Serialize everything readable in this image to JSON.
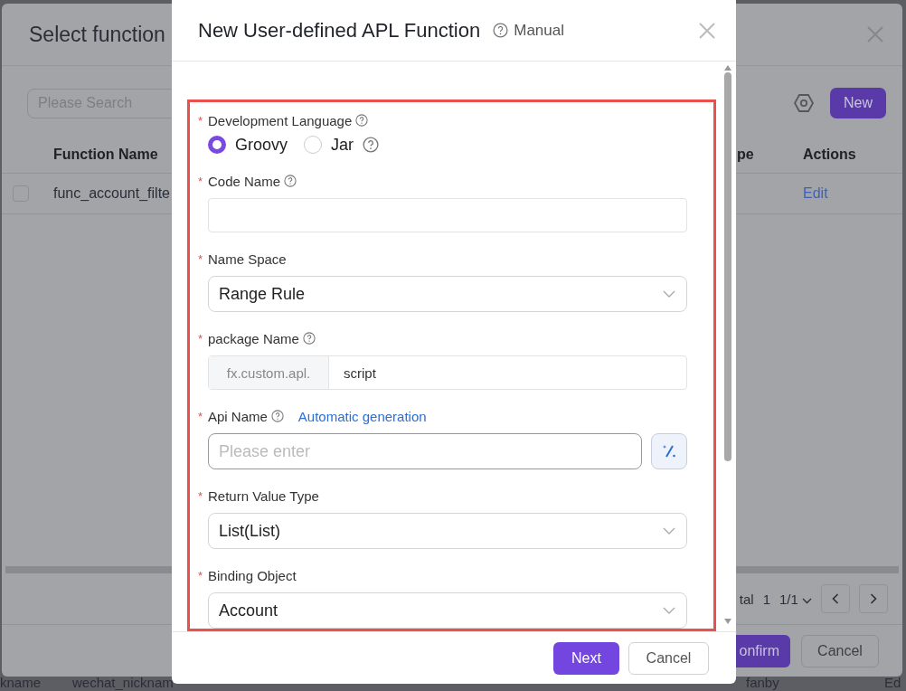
{
  "background_page": {
    "row_texts": [
      "kname",
      "wechat_nicknam",
      "fanby",
      "Ed"
    ]
  },
  "select_dialog": {
    "title": "Select function",
    "search": {
      "placeholder": "Please Search"
    },
    "new_button": "New",
    "columns": [
      "Function Name",
      "pe",
      "Actions"
    ],
    "rows": [
      {
        "checked": false,
        "function_name": "func_account_filte",
        "action": "Edit"
      }
    ],
    "pagination": {
      "total_label": "tal",
      "total": "1",
      "page": "1/1"
    },
    "buttons": [
      {
        "label": "onfirm",
        "kind": "primary"
      },
      {
        "label": "Cancel",
        "kind": "default"
      }
    ]
  },
  "modal": {
    "title": "New User-defined APL Function",
    "manual": "Manual",
    "fields": [
      {
        "kind": "radio",
        "label": "Development Language",
        "asterisk": "*",
        "help": true,
        "options": [
          {
            "label": "Groovy",
            "selected": true,
            "help": false
          },
          {
            "label": "Jar",
            "selected": false,
            "help": true
          }
        ]
      },
      {
        "kind": "text",
        "label": "Code Name",
        "asterisk": "*",
        "help": true
      },
      {
        "kind": "select",
        "label": "Name Space",
        "asterisk": "*",
        "help": false,
        "value": "Range Rule"
      },
      {
        "kind": "prefixed",
        "label": "package Name",
        "asterisk": "*",
        "help": true,
        "prefix": "fx.custom.apl.",
        "value": "script"
      },
      {
        "kind": "generate",
        "label": "Api Name",
        "asterisk": "*",
        "help": true,
        "link": "Automatic generation",
        "placeholder": "Please enter"
      },
      {
        "kind": "select",
        "label": "Return Value Type",
        "asterisk": "*",
        "help": false,
        "value": "List(List)"
      },
      {
        "kind": "select",
        "label": "Binding Object",
        "asterisk": "*",
        "help": false,
        "value": "Account"
      }
    ],
    "buttons": [
      {
        "label": "Next",
        "kind": "primary"
      },
      {
        "label": "Cancel",
        "kind": "default"
      }
    ]
  }
}
